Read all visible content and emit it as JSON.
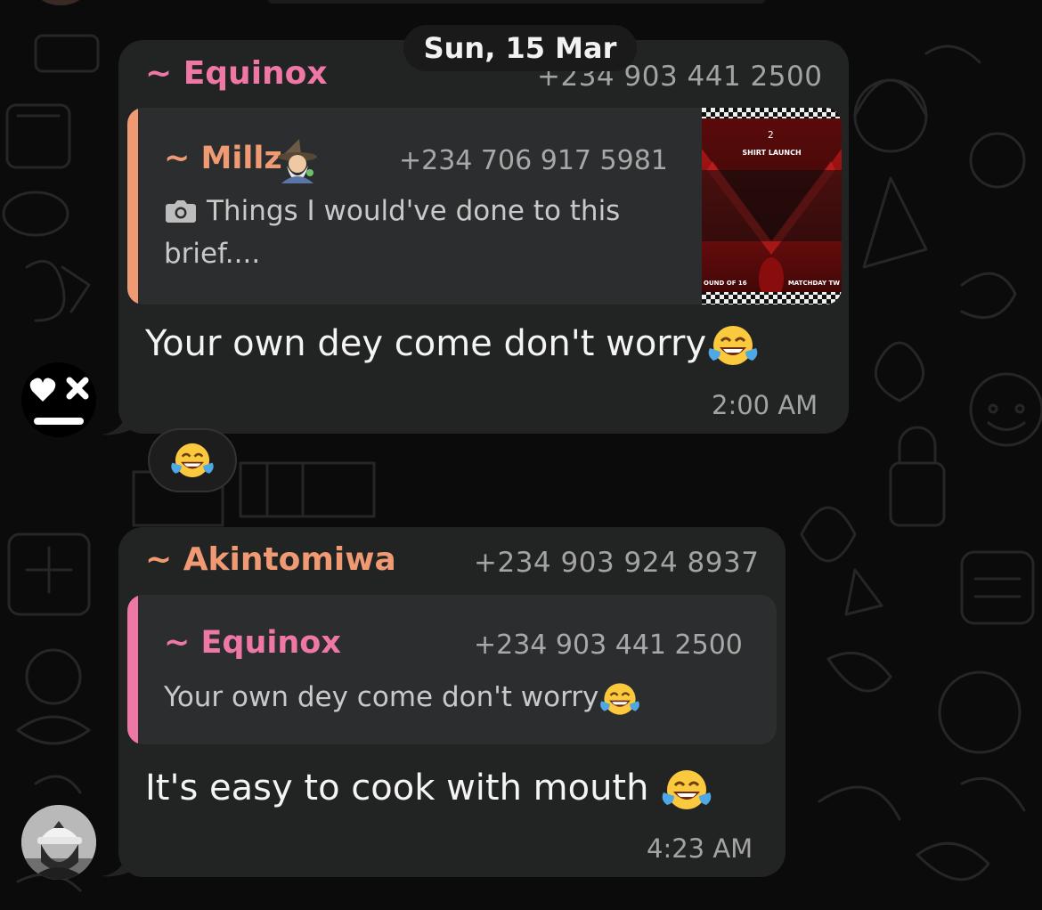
{
  "colors": {
    "equinox": "#ee77a6",
    "millz": "#ef9a72",
    "akintomiwa": "#ef9a72",
    "bubble": "#222323",
    "quote": "#2c2d2e"
  },
  "date_separator": "Sun, 15 Mar",
  "message1": {
    "sender": "~ Equinox",
    "phone": "+234 903 441 2500",
    "reply": {
      "sender": "~ Millz",
      "sender_emoji": "mage-emoji",
      "phone": "+234 706 917 5981",
      "media_icon": "camera-icon",
      "text_line1": "Things I would've done to this",
      "text_line2": "brief....",
      "thumbnail": {
        "top_number": "2",
        "title": "SHIRT LAUNCH",
        "bottom_left": "OUND OF 16",
        "bottom_right": "MATCHDAY TW"
      }
    },
    "text": "Your own dey come don't worry",
    "emoji": "laughing-tears-emoji",
    "time": "2:00 AM",
    "reaction": "laughing-tears-emoji"
  },
  "message2": {
    "sender": "~ Akintomiwa",
    "phone": "+234 903 924 8937",
    "reply": {
      "sender": "~ Equinox",
      "phone": "+234 903 441 2500",
      "text": "Your own dey come don't worry"
    },
    "text": "It's easy to cook with mouth ",
    "emoji": "laughing-tears-emoji",
    "time": "4:23 AM"
  }
}
